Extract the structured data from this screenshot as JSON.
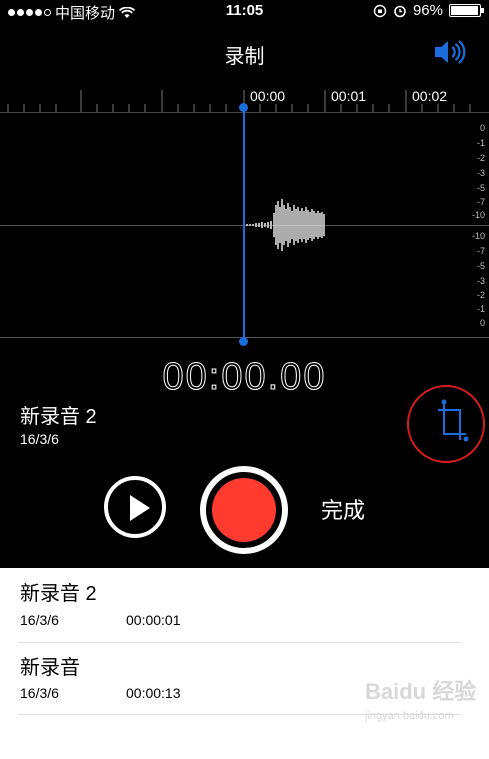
{
  "status_bar": {
    "carrier": "中国移动",
    "time": "11:05",
    "battery": "96%"
  },
  "header": {
    "title": "录制",
    "speaker_icon": "speaker-volume-icon"
  },
  "ruler": {
    "labels": [
      "00:00",
      "00:01",
      "00:02"
    ]
  },
  "waveform": {
    "db_scale_top": [
      "0",
      "-1",
      "-2",
      "-3",
      "-5",
      "-7",
      "-10"
    ],
    "db_scale_bottom": [
      "-10",
      "-7",
      "-5",
      "-3",
      "-2",
      "-1",
      "0"
    ]
  },
  "timer": "00:00.00",
  "current_recording": {
    "name": "新录音 2",
    "date": "16/3/6"
  },
  "controls": {
    "done_label": "完成"
  },
  "recordings": [
    {
      "name": "新录音 2",
      "date": "16/3/6",
      "duration": "00:00:01"
    },
    {
      "name": "新录音",
      "date": "16/3/6",
      "duration": "00:00:13"
    }
  ],
  "watermark": {
    "brand": "Baidu 经验",
    "url": "jingyan.baidu.com"
  },
  "colors": {
    "accent_blue": "#1a6ddb",
    "record_red": "#ff3b30",
    "highlight_red": "#d41e1e"
  }
}
